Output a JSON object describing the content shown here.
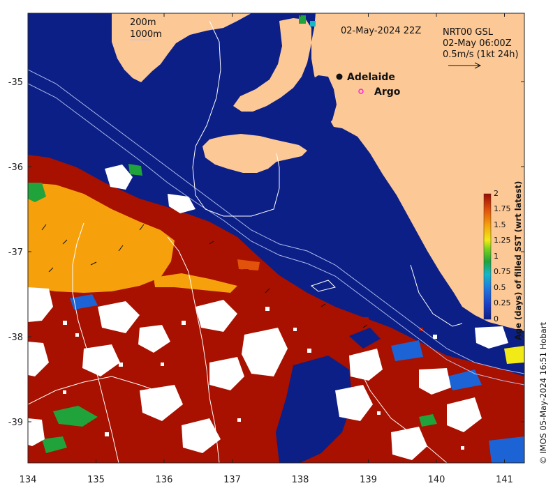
{
  "map": {
    "date_label": "02-May-2024 22Z",
    "model_label": "NRT00 GSL",
    "current_time": "02-May 06:00Z",
    "scale_label": "0.5m/s (1kt 24h)",
    "isobath_1": "200m",
    "isobath_2": "1000m",
    "places": [
      {
        "name": "Adelaide",
        "lon": 138.58,
        "lat": -34.93,
        "marker": "filled-dot"
      },
      {
        "name": "Argo",
        "lon": 138.88,
        "lat": -35.12,
        "marker": "magenta-circle"
      }
    ],
    "credit": "© IMOS 05-May-2024 16:51 Hobart"
  },
  "axes": {
    "x_ticks": [
      "134",
      "135",
      "136",
      "137",
      "138",
      "139",
      "140",
      "141"
    ],
    "y_ticks": [
      "-35",
      "-36",
      "-37",
      "-38",
      "-39"
    ],
    "xlim": [
      134,
      141.3
    ],
    "ylim": [
      -39.5,
      -34.2
    ]
  },
  "colorbar": {
    "title": "Age (days) of filled SST (wrt latest)",
    "ticks": [
      "0",
      "0.25",
      "0.5",
      "0.75",
      "1",
      "1.25",
      "1.5",
      "1.75",
      "2"
    ],
    "range": [
      0,
      2
    ]
  },
  "colors": {
    "ocean_deep": "#0c1f86",
    "land": "#fcc896",
    "no_data": "#ffffff",
    "age_2": "#a81000",
    "age_1_5": "#f6a10c",
    "age_1": "#1fa33a",
    "age_0_5": "#1c64d6"
  }
}
